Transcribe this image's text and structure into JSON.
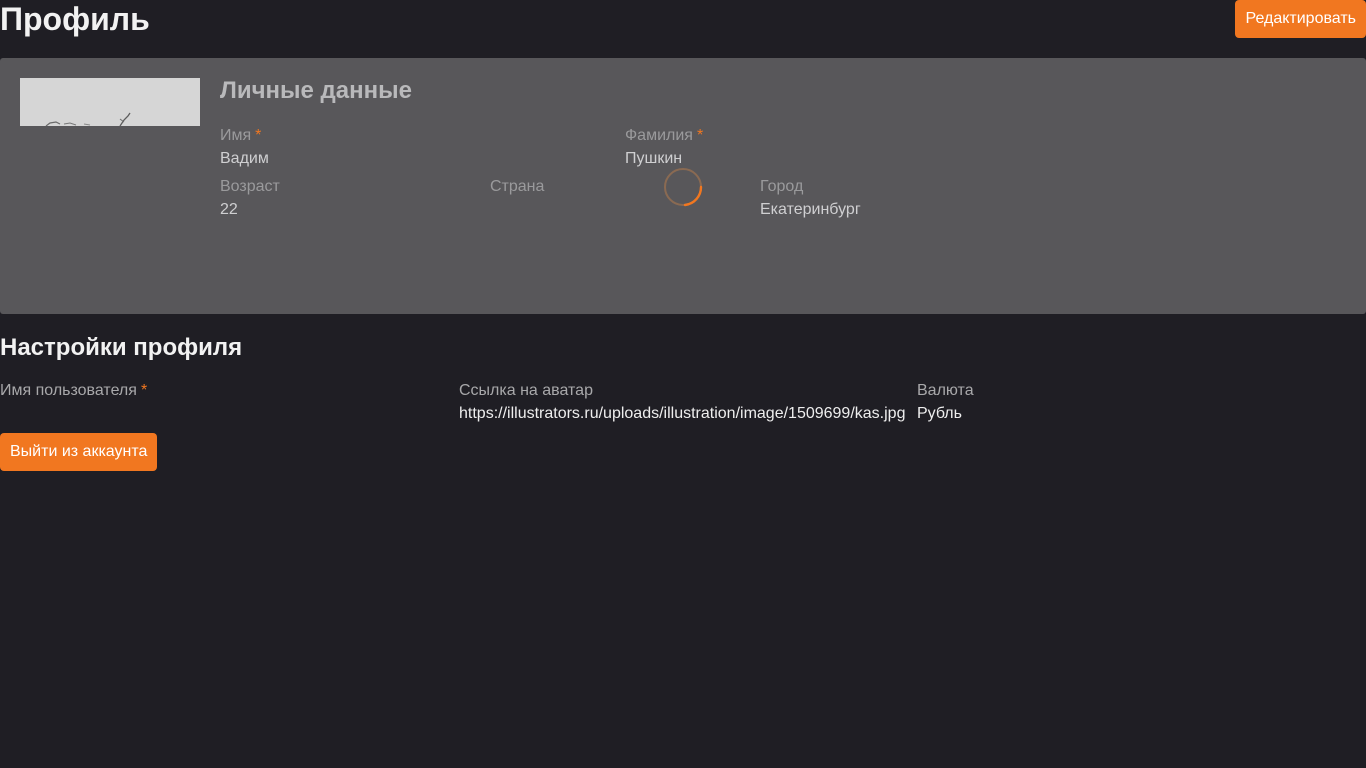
{
  "header": {
    "title": "Профиль",
    "edit_label": "Редактировать"
  },
  "personal": {
    "title": "Личные данные",
    "first_name": {
      "label": "Имя",
      "required_mark": "*",
      "value": "Вадим"
    },
    "last_name": {
      "label": "Фамилия",
      "required_mark": "*",
      "value": "Пушкин"
    },
    "age": {
      "label": "Возраст",
      "value": "22"
    },
    "country": {
      "label": "Страна",
      "value": ""
    },
    "city": {
      "label": "Город",
      "value": "Екатеринбург"
    },
    "loading_spinner": "spinner-icon"
  },
  "settings": {
    "title": "Настройки профиля",
    "username": {
      "label": "Имя пользователя",
      "required_mark": "*",
      "value": ""
    },
    "avatar_link": {
      "label": "Ссылка на аватар",
      "value": "https://illustrators.ru/uploads/illustration/image/1509699/kas.jpg"
    },
    "currency": {
      "label": "Валюта",
      "value": "Рубль"
    },
    "logout_label": "Выйти из аккаунта"
  },
  "colors": {
    "accent": "#f17720",
    "background": "#1f1e24",
    "card": "#58575a"
  }
}
